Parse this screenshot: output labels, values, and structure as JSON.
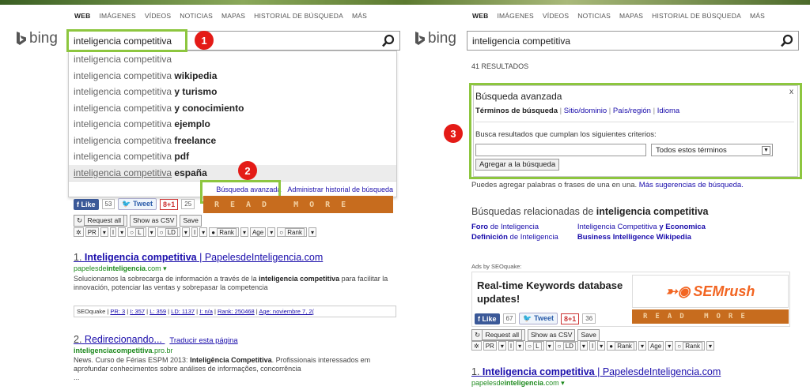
{
  "nav": [
    "WEB",
    "IMÁGENES",
    "VÍDEOS",
    "NOTICIAS",
    "MAPAS",
    "HISTORIAL DE BÚSQUEDA",
    "MÁS"
  ],
  "logo": "bing",
  "query": "inteligencia competitiva",
  "badges": [
    "1",
    "2",
    "3"
  ],
  "suggestions": [
    {
      "base": "inteligencia competitiva",
      "extra": ""
    },
    {
      "base": "inteligencia competitiva",
      "extra": "wikipedia"
    },
    {
      "base": "inteligencia competitiva",
      "extra": "y turismo"
    },
    {
      "base": "inteligencia competitiva",
      "extra": "y conocimiento"
    },
    {
      "base": "inteligencia competitiva",
      "extra": "ejemplo"
    },
    {
      "base": "inteligencia competitiva",
      "extra": "freelance"
    },
    {
      "base": "inteligencia competitiva",
      "extra": "pdf"
    },
    {
      "base": "inteligencia competitiva",
      "extra": "españa"
    }
  ],
  "suggest_footer": {
    "advanced": "Búsqueda avanzada",
    "manage": "Administrar historial de búsqueda"
  },
  "social_left": {
    "like": "Like",
    "like_count": "53",
    "tweet": "Tweet",
    "gplus": "+1",
    "gplus_count": "25"
  },
  "social_right": {
    "like": "Like",
    "like_count": "67",
    "tweet": "Tweet",
    "gplus": "+1",
    "gplus_count": "36"
  },
  "readmore": "READ MORE",
  "buttons": [
    "Request all",
    "Show as CSV",
    "Save"
  ],
  "seoquake_bar": [
    "PR",
    "I",
    "L",
    "LD",
    "I",
    "Rank",
    "Age",
    "Rank"
  ],
  "results_count": "41 RESULTADOS",
  "result1": {
    "num": "1.",
    "title_bold": "Inteligencia competitiva",
    "title_rest": " | PapelesdeInteligencia.com",
    "url_pre": "papelesde",
    "url_bold": "inteligencia",
    "url_post": ".com",
    "desc_a": "Solucionamos la sobrecarga de información a través de la ",
    "desc_bold": "inteligencia competitiva",
    "desc_b": " para facilitar la innovación, potenciar las ventas y sobrepasar la competencia"
  },
  "sq_line": {
    "label": "SEOquake",
    "pr": "PR: 3",
    "i": "I: 357",
    "l": "L: 359",
    "ld": "LD: 1137",
    "i2": "I: n/a",
    "rank": "Rank: 250468",
    "age": "Age: noviembre 7, 2("
  },
  "result2": {
    "num": "2.",
    "title": "Redirecionando...",
    "translate": "Traducir esta página",
    "url_bold": "inteligenciacompetitiva",
    "url_post": ".pro.br",
    "desc_a": "News. Curso de Férias ESPM 2013: ",
    "desc_bold": "Inteligência Competitiva",
    "desc_b": ". Profissionais interessados em aprofundar conhecimentos sobre análises de informações, concorrência",
    "more": "..."
  },
  "advanced": {
    "title": "Búsqueda avanzada",
    "close": "x",
    "tabs": [
      "Términos de búsqueda",
      "Sitio/dominio",
      "País/región",
      "Idioma"
    ],
    "criteria": "Busca resultados que cumplan los siguientes criterios:",
    "dropdown": "Todos estos términos",
    "add_button": "Agregar a la búsqueda",
    "note": "Puedes agregar palabras o frases de una en una.",
    "more_link": "Más sugerencias de búsqueda."
  },
  "related": {
    "heading_pre": "Búsquedas relacionadas de ",
    "heading_bold": "inteligencia competitiva",
    "col1": [
      {
        "bold": "Foro",
        "rest": " de Inteligencia"
      },
      {
        "bold": "Definición",
        "rest": " de Inteligencia"
      }
    ],
    "col2": [
      {
        "pre": "Inteligencia Competitiva ",
        "bold": "y Economica"
      },
      {
        "pre": "",
        "bold": "Business Intelligence Wikipedia"
      }
    ]
  },
  "ads_label": "Ads by SEOquake:",
  "ad_text": "Real-time Keywords database updates!",
  "semrush": "SEMrush",
  "colors": {
    "highlight": "#8dc63f",
    "badge": "#e41b17",
    "link": "#1a0dab",
    "url": "#1e8a1e",
    "readmore_bg": "#c76c1e"
  }
}
